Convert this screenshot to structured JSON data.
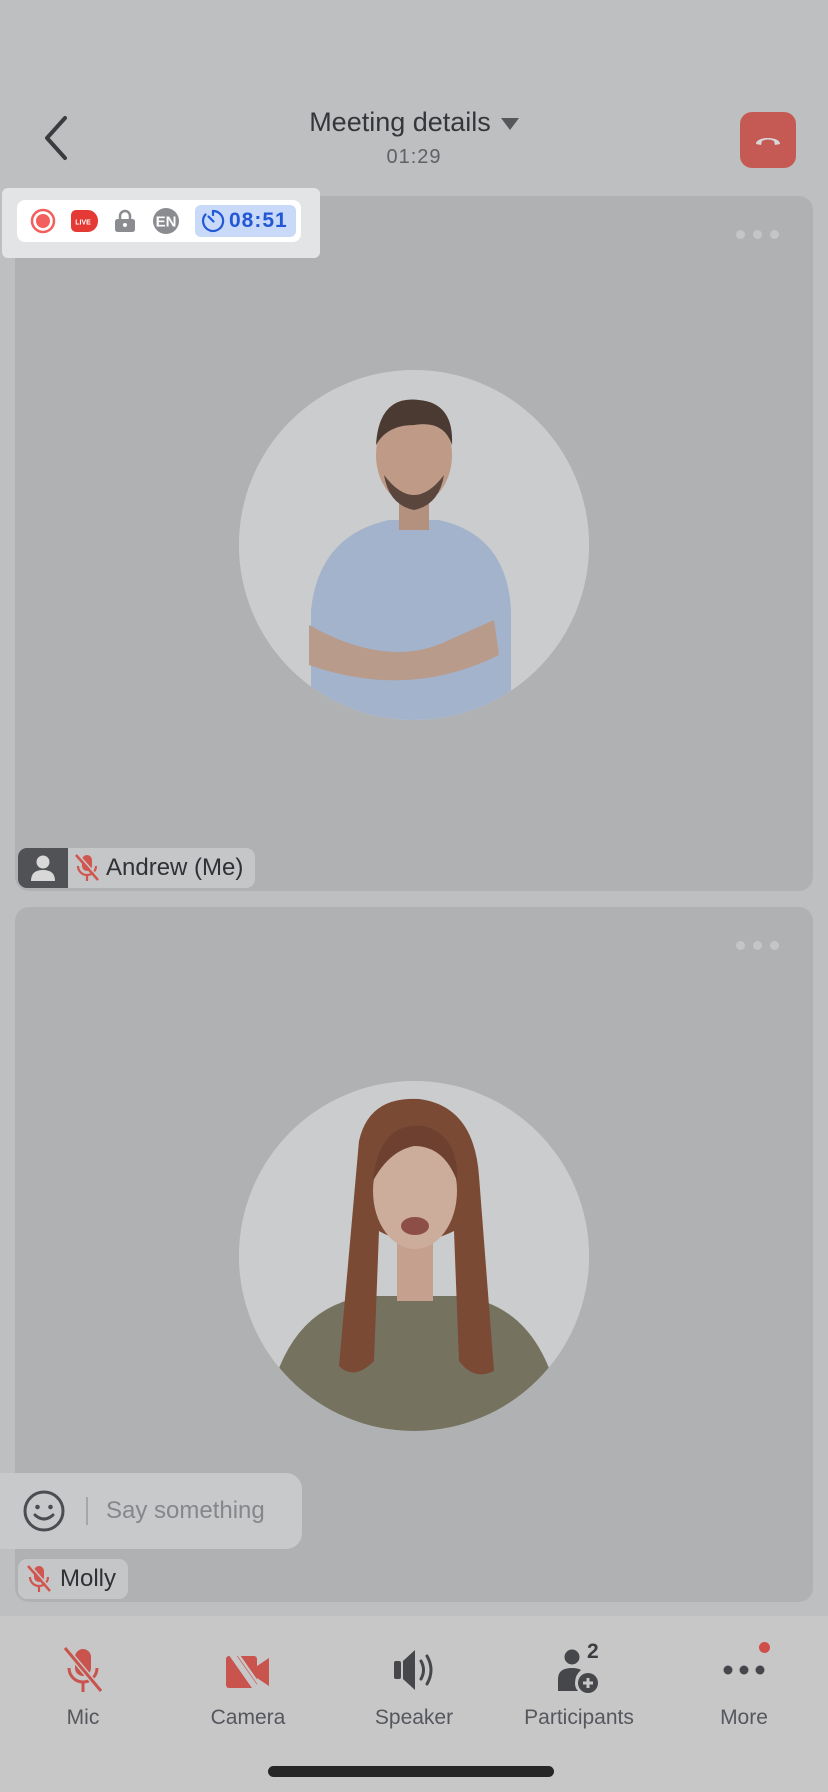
{
  "header": {
    "title": "Meeting details",
    "duration": "01:29",
    "back_icon": "chevron-left-icon",
    "end_call_icon": "phone-hangup-icon"
  },
  "status_bar": {
    "icons": [
      "record-icon",
      "live-icon",
      "lock-icon",
      "language-icon"
    ],
    "live_label": "LIVE",
    "language": "EN",
    "timer": "08:51",
    "timer_icon": "timer-icon"
  },
  "participants": [
    {
      "name": "Andrew (Me)",
      "mic_muted": true,
      "is_me": true
    },
    {
      "name": "Molly",
      "mic_muted": true,
      "is_me": false
    }
  ],
  "chat": {
    "placeholder": "Say something",
    "emoji_icon": "smiley-icon"
  },
  "toolbar": {
    "items": [
      {
        "label": "Mic",
        "icon": "mic-off-icon",
        "state": "off"
      },
      {
        "label": "Camera",
        "icon": "camera-off-icon",
        "state": "off"
      },
      {
        "label": "Speaker",
        "icon": "speaker-icon",
        "state": "on"
      },
      {
        "label": "Participants",
        "icon": "add-participant-icon",
        "count": "2"
      },
      {
        "label": "More",
        "icon": "more-icon",
        "has_notification": true
      }
    ]
  },
  "colors": {
    "danger": "#c55a55",
    "timer_accent": "#2257d6",
    "timer_bg": "#c9daf8",
    "record_red": "#f25f5c"
  }
}
